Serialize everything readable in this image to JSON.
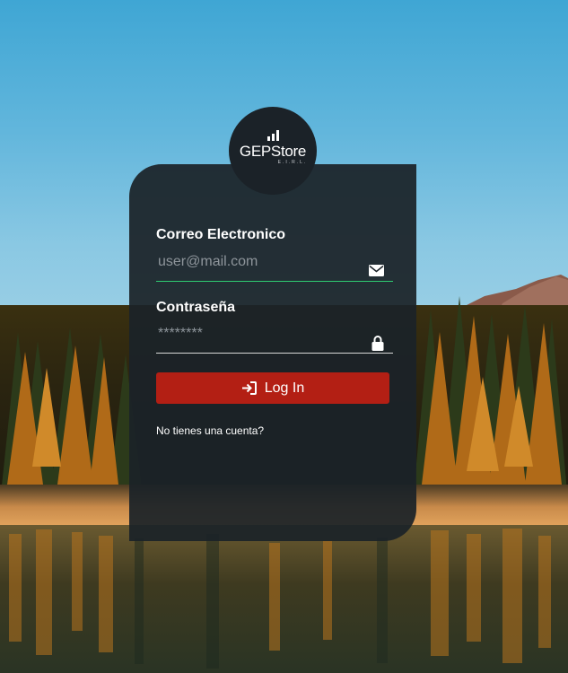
{
  "brand": {
    "name": "GEPStore",
    "suffix": "E.I.R.L."
  },
  "form": {
    "email": {
      "label": "Correo Electronico",
      "placeholder": "user@mail.com",
      "value": "",
      "icon": "envelope-icon",
      "underline_color": "#2ecc71"
    },
    "password": {
      "label": "Contraseña",
      "placeholder": "********",
      "value": "",
      "icon": "lock-icon",
      "underline_color": "#d9d9d9"
    },
    "login_button": {
      "label": "Log In",
      "icon": "login-arrow-icon",
      "color": "#b31f14"
    },
    "signup_link": "No tienes una cuenta?"
  }
}
